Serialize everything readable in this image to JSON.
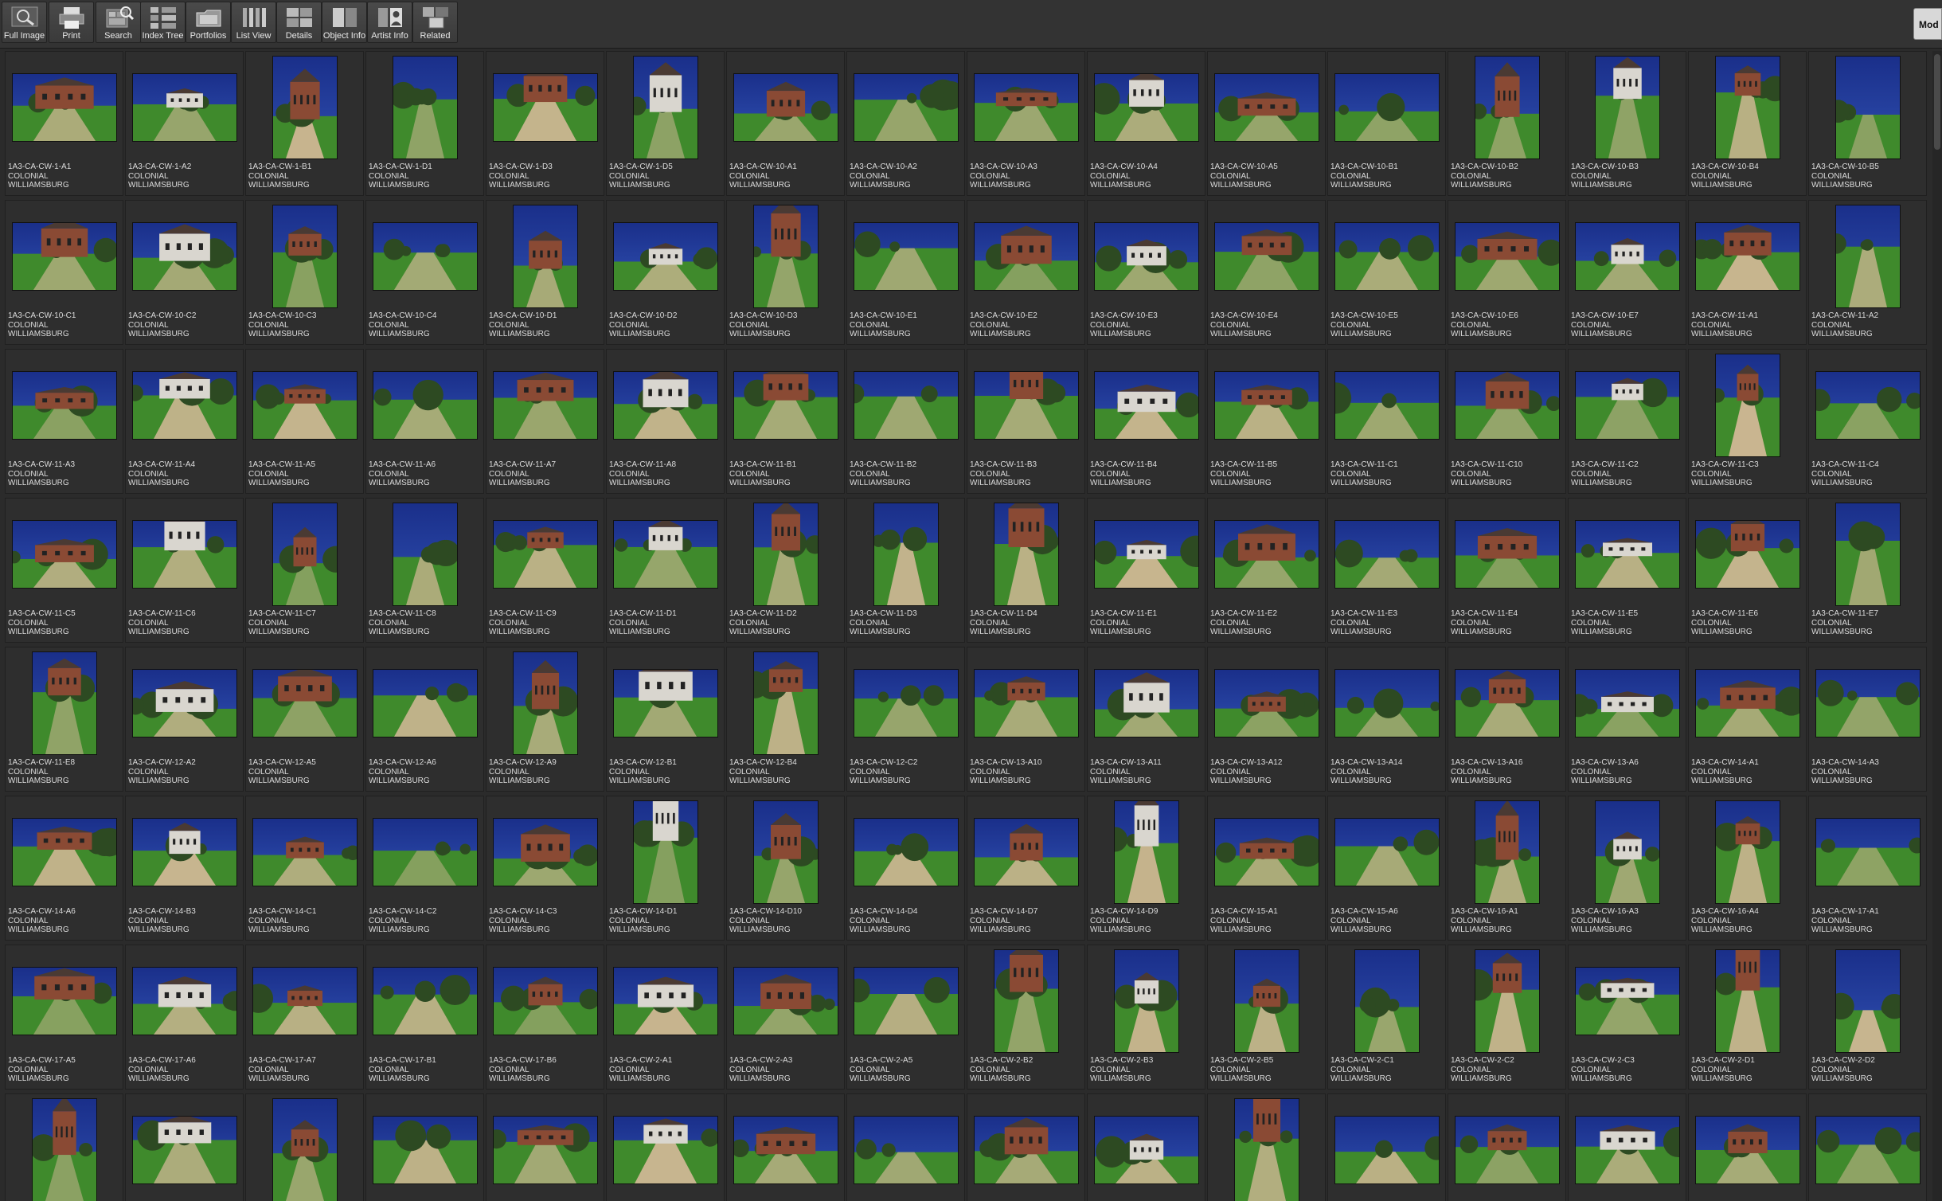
{
  "toolbar": {
    "buttons": [
      {
        "label": "Full Image",
        "icon": "magnifier-icon"
      },
      {
        "label": "Print",
        "icon": "printer-icon"
      },
      {
        "label": "Search",
        "icon": "search-icon"
      },
      {
        "label": "Index Tree",
        "icon": "index-tree-icon"
      },
      {
        "label": "Portfolios",
        "icon": "portfolio-icon"
      },
      {
        "label": "List View",
        "icon": "list-view-icon"
      },
      {
        "label": "Details",
        "icon": "details-icon"
      },
      {
        "label": "Object Info",
        "icon": "object-info-icon"
      },
      {
        "label": "Artist  Info",
        "icon": "artist-info-icon"
      },
      {
        "label": "Related",
        "icon": "related-icon"
      }
    ],
    "mode_label": "Mod"
  },
  "caption_line2": "COLONIAL",
  "caption_line3": "WILLIAMSBURG",
  "rows": [
    [
      "1A3-CA-CW-1-A1",
      "1A3-CA-CW-1-A2",
      "1A3-CA-CW-1-B1",
      "1A3-CA-CW-1-D1",
      "1A3-CA-CW-1-D3",
      "1A3-CA-CW-1-D5",
      "1A3-CA-CW-10-A1",
      "1A3-CA-CW-10-A2",
      "1A3-CA-CW-10-A3",
      "1A3-CA-CW-10-A4",
      "1A3-CA-CW-10-A5",
      "1A3-CA-CW-10-B1",
      "1A3-CA-CW-10-B2",
      "1A3-CA-CW-10-B3",
      "1A3-CA-CW-10-B4",
      "1A3-CA-CW-10-B5"
    ],
    [
      "1A3-CA-CW-10-C1",
      "1A3-CA-CW-10-C2",
      "1A3-CA-CW-10-C3",
      "1A3-CA-CW-10-C4",
      "1A3-CA-CW-10-D1",
      "1A3-CA-CW-10-D2",
      "1A3-CA-CW-10-D3",
      "1A3-CA-CW-10-E1",
      "1A3-CA-CW-10-E2",
      "1A3-CA-CW-10-E3",
      "1A3-CA-CW-10-E4",
      "1A3-CA-CW-10-E5",
      "1A3-CA-CW-10-E6",
      "1A3-CA-CW-10-E7",
      "1A3-CA-CW-11-A1",
      "1A3-CA-CW-11-A2"
    ],
    [
      "1A3-CA-CW-11-A3",
      "1A3-CA-CW-11-A4",
      "1A3-CA-CW-11-A5",
      "1A3-CA-CW-11-A6",
      "1A3-CA-CW-11-A7",
      "1A3-CA-CW-11-A8",
      "1A3-CA-CW-11-B1",
      "1A3-CA-CW-11-B2",
      "1A3-CA-CW-11-B3",
      "1A3-CA-CW-11-B4",
      "1A3-CA-CW-11-B5",
      "1A3-CA-CW-11-C1",
      "1A3-CA-CW-11-C10",
      "1A3-CA-CW-11-C2",
      "1A3-CA-CW-11-C3",
      "1A3-CA-CW-11-C4"
    ],
    [
      "1A3-CA-CW-11-C5",
      "1A3-CA-CW-11-C6",
      "1A3-CA-CW-11-C7",
      "1A3-CA-CW-11-C8",
      "1A3-CA-CW-11-C9",
      "1A3-CA-CW-11-D1",
      "1A3-CA-CW-11-D2",
      "1A3-CA-CW-11-D3",
      "1A3-CA-CW-11-D4",
      "1A3-CA-CW-11-E1",
      "1A3-CA-CW-11-E2",
      "1A3-CA-CW-11-E3",
      "1A3-CA-CW-11-E4",
      "1A3-CA-CW-11-E5",
      "1A3-CA-CW-11-E6",
      "1A3-CA-CW-11-E7"
    ],
    [
      "1A3-CA-CW-11-E8",
      "1A3-CA-CW-12-A2",
      "1A3-CA-CW-12-A5",
      "1A3-CA-CW-12-A6",
      "1A3-CA-CW-12-A9",
      "1A3-CA-CW-12-B1",
      "1A3-CA-CW-12-B4",
      "1A3-CA-CW-12-C2",
      "1A3-CA-CW-13-A10",
      "1A3-CA-CW-13-A11",
      "1A3-CA-CW-13-A12",
      "1A3-CA-CW-13-A14",
      "1A3-CA-CW-13-A16",
      "1A3-CA-CW-13-A6",
      "1A3-CA-CW-14-A1",
      "1A3-CA-CW-14-A3"
    ],
    [
      "1A3-CA-CW-14-A6",
      "1A3-CA-CW-14-B3",
      "1A3-CA-CW-14-C1",
      "1A3-CA-CW-14-C2",
      "1A3-CA-CW-14-C3",
      "1A3-CA-CW-14-D1",
      "1A3-CA-CW-14-D10",
      "1A3-CA-CW-14-D4",
      "1A3-CA-CW-14-D7",
      "1A3-CA-CW-14-D9",
      "1A3-CA-CW-15-A1",
      "1A3-CA-CW-15-A6",
      "1A3-CA-CW-16-A1",
      "1A3-CA-CW-16-A3",
      "1A3-CA-CW-16-A4",
      "1A3-CA-CW-17-A1"
    ],
    [
      "1A3-CA-CW-17-A5",
      "1A3-CA-CW-17-A6",
      "1A3-CA-CW-17-A7",
      "1A3-CA-CW-17-B1",
      "1A3-CA-CW-17-B6",
      "1A3-CA-CW-2-A1",
      "1A3-CA-CW-2-A3",
      "1A3-CA-CW-2-A5",
      "1A3-CA-CW-2-B2",
      "1A3-CA-CW-2-B3",
      "1A3-CA-CW-2-B5",
      "1A3-CA-CW-2-C1",
      "1A3-CA-CW-2-C2",
      "1A3-CA-CW-2-C3",
      "1A3-CA-CW-2-D1",
      "1A3-CA-CW-2-D2"
    ],
    [
      "",
      "",
      "",
      "",
      "",
      "",
      "",
      "",
      "",
      "",
      "",
      "",
      "",
      "",
      "",
      ""
    ]
  ],
  "orientation_rows": [
    "LLPPLPLLLLLLPPPP",
    "LLPLPLPLLLLLLLLP",
    "LLLLLLLLLLLLLLPL",
    "LLPPLLPPPLLLLLLP",
    "PLLLPLPLLLLLLLLL",
    "LLLLLPPLLPLLPPPL",
    "LLLLLLLLPPPPPLPP",
    "PLPLLLLLLLPLLLLL"
  ],
  "scenes": {
    "sky": "#2f4fb0",
    "sky_deep": "#1a2f8a",
    "grass": "#3f8a2c",
    "path": "#c9b590",
    "brick": "#8a4a34",
    "white_building": "#d9d6cf",
    "tree": "#2d4a22",
    "night": "#101a4a"
  }
}
